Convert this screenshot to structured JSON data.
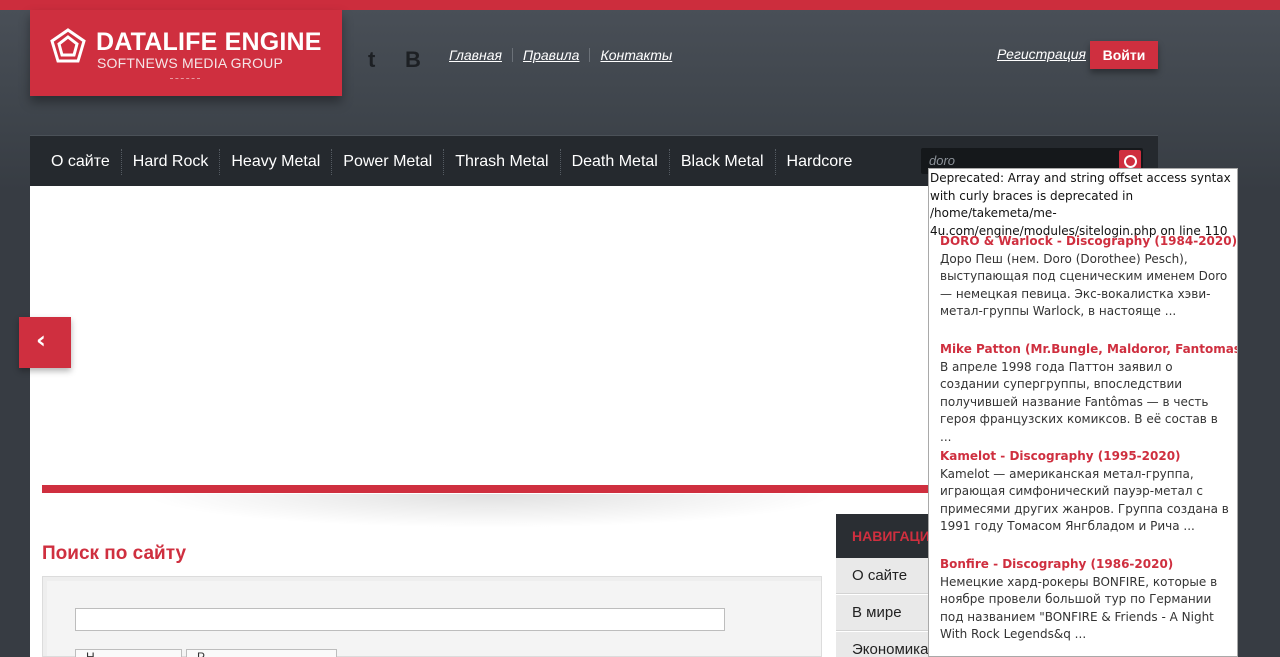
{
  "brand": {
    "title": "DATALIFE ENGINE",
    "subtitle": "SOFTNEWS MEDIA GROUP"
  },
  "social": {
    "twitter_glyph": "t",
    "vk_glyph": "B"
  },
  "top_links": [
    "Главная",
    "Правила",
    "Контакты"
  ],
  "auth": {
    "register_label": "Регистрация",
    "login_label": "Войти"
  },
  "nav": [
    "О сайте",
    "Hard Rock",
    "Heavy Metal",
    "Power Metal",
    "Thrash Metal",
    "Death Metal",
    "Black Metal",
    "Hardcore"
  ],
  "quick_search": {
    "value": "doro"
  },
  "search_results": {
    "warning": "Deprecated: Array and string offset access syntax with curly braces is deprecated in /home/takemeta/me-4u.com/engine/modules/sitelogin.php on line 110",
    "items": [
      {
        "title": "DORO & Warlock - Discography (1984-2020)",
        "snippet": "Доро Пеш (нем. Doro (Dorothee) Pesch), выступающая под сценическим именем Doro — немецкая певица. Экс-вокалистка хэви-метал-группы Warlock, в настояще ..."
      },
      {
        "title": "Mike Patton (Mr.Bungle, Maldoror, Fantomas, ...",
        "snippet": "В апреле 1998 года Паттон заявил о создании супергруппы, впоследствии получившей название Fantômas — в честь героя французских комиксов. В её состав в ..."
      },
      {
        "title": "Kamelot - Discography (1995-2020)",
        "snippet": "Kamelot — американская метал-группа, играющая симфонический пауэр-метал с примесями других жанров. Группа создана в 1991 году Томасом Янгбладом и Рича ..."
      },
      {
        "title": "Bonfire - Discography (1986-2020)",
        "snippet": "Немецкие хард-рокеры BONFIRE, которые в ноябре провели большой тур по Германии под названием \"BONFIRE & Friends - A Night With Rock Legends&q ..."
      }
    ]
  },
  "page": {
    "prev_arrow": "‹",
    "search_title": "Поиск по сайту",
    "button_a": "Н",
    "button_b": "Р"
  },
  "sidebar": {
    "heading": "НАВИГАЦИ",
    "items": [
      "О сайте",
      "В мире",
      "Экономика"
    ]
  },
  "colors": {
    "accent": "#cf2f3f",
    "nav_bg": "#25292e"
  }
}
